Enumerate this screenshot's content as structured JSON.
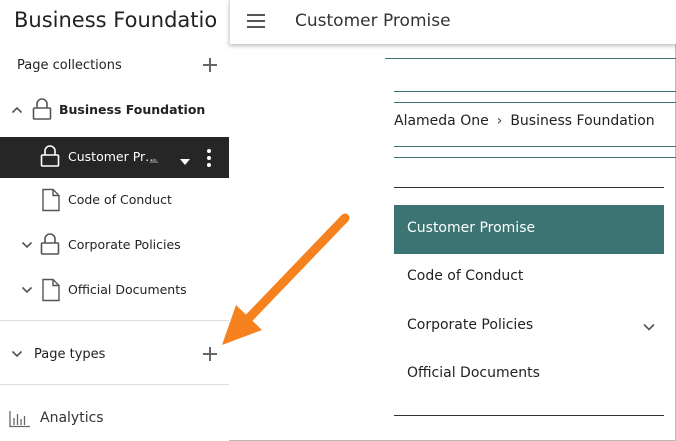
{
  "sidebar": {
    "app_title": "Business Foundatio",
    "page_collections_label": "Page collections",
    "tree": [
      {
        "label": "Business Foundation",
        "icon": "lock-icon",
        "chevron": "up",
        "bold": true
      },
      {
        "label": "Customer Pr…",
        "icon": "lock-icon",
        "selected": true
      },
      {
        "label": "Code of Conduct",
        "icon": "document-icon"
      },
      {
        "label": "Corporate Policies",
        "icon": "lock-icon",
        "chevron": "down"
      },
      {
        "label": "Official Documents",
        "icon": "document-icon",
        "chevron": "down"
      }
    ],
    "page_types_label": "Page types",
    "analytics_label": "Analytics"
  },
  "header": {
    "title": "Customer Promise"
  },
  "main": {
    "breadcrumb": [
      "Alameda One",
      "Business Foundation"
    ],
    "breadcrumb_separator": "›",
    "nav": [
      {
        "label": "Customer Promise",
        "active": true
      },
      {
        "label": "Code of Conduct"
      },
      {
        "label": "Corporate Policies",
        "has_children": true
      },
      {
        "label": "Official Documents"
      }
    ]
  },
  "colors": {
    "accent": "#3c7474",
    "selected_row": "#262626",
    "annotation_arrow": "#f5821f"
  }
}
